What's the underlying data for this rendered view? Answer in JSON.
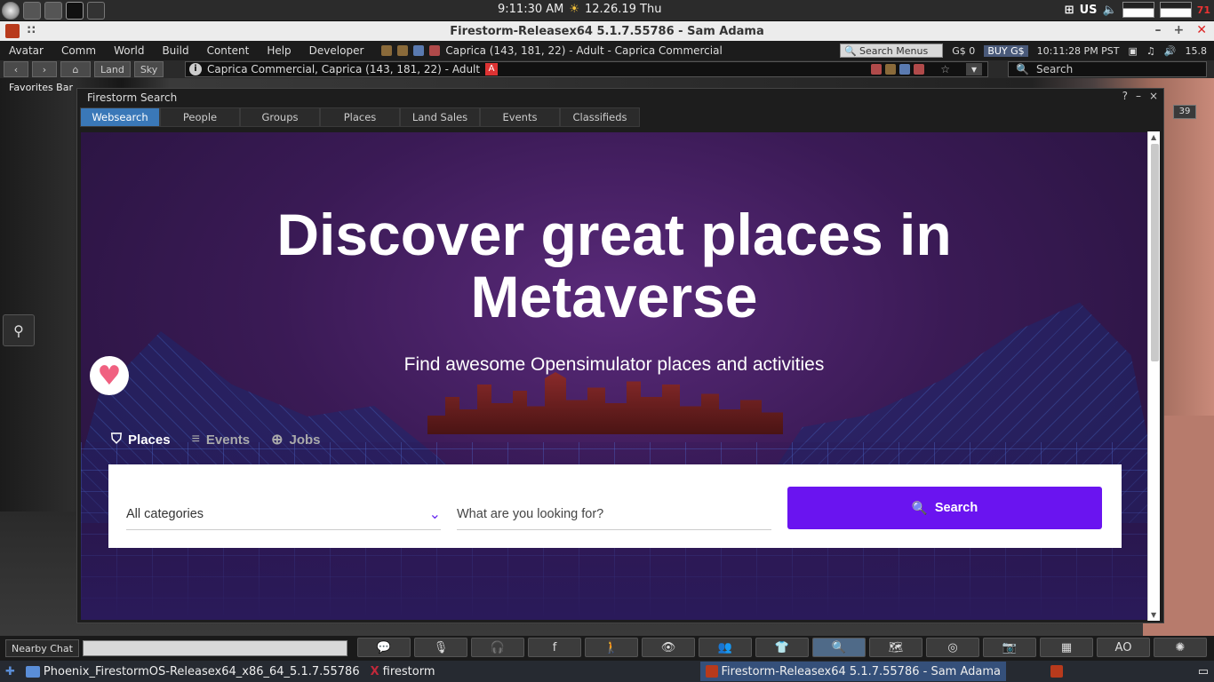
{
  "system": {
    "clock": "9:11:30 AM",
    "date": "12.26.19 Thu",
    "keyboard": "US",
    "indicator": "71"
  },
  "window": {
    "title": "Firestorm-Releasex64 5.1.7.55786 - Sam Adama",
    "dots": "::"
  },
  "menu": {
    "items": [
      "Avatar",
      "Comm",
      "World",
      "Build",
      "Content",
      "Help",
      "Developer"
    ],
    "location": "Caprica (143, 181, 22) - Adult - Caprica Commercial",
    "search_placeholder": "Search Menus",
    "balance": "G$ 0",
    "buy": "BUY G$",
    "time": "10:11:28 PM PST",
    "fps": "15.8"
  },
  "navbar": {
    "land": "Land",
    "sky": "Sky",
    "location": "Caprica Commercial, Caprica (143, 181, 22) - Adult",
    "rating": "A",
    "search": "Search"
  },
  "favorites_bar": "Favorites Bar",
  "counter": "39",
  "floater": {
    "title": "Firestorm Search",
    "controls": [
      "?",
      "–",
      "×"
    ],
    "tabs": [
      {
        "label": "Websearch",
        "active": true
      },
      {
        "label": "People"
      },
      {
        "label": "Groups"
      },
      {
        "label": "Places"
      },
      {
        "label": "Land Sales"
      },
      {
        "label": "Events"
      },
      {
        "label": "Classifieds"
      }
    ]
  },
  "web": {
    "headline_line1": "Discover great places in",
    "headline_line2": "Metaverse",
    "subline": "Find awesome Opensimulator places and activities",
    "tabs": {
      "places": "Places",
      "events": "Events",
      "jobs": "Jobs"
    },
    "category": "All categories",
    "query_placeholder": "What are you looking for?",
    "search_button": "Search",
    "accent": "#6a14f0"
  },
  "bottom": {
    "nearby_chat": "Nearby Chat",
    "ao": "AO"
  },
  "taskbar": {
    "folder": "Phoenix_FirestormOS-Releasex64_x86_64_5.1.7.55786",
    "terminal": "firestorm",
    "active_window": "Firestorm-Releasex64 5.1.7.55786 - Sam Adama"
  }
}
